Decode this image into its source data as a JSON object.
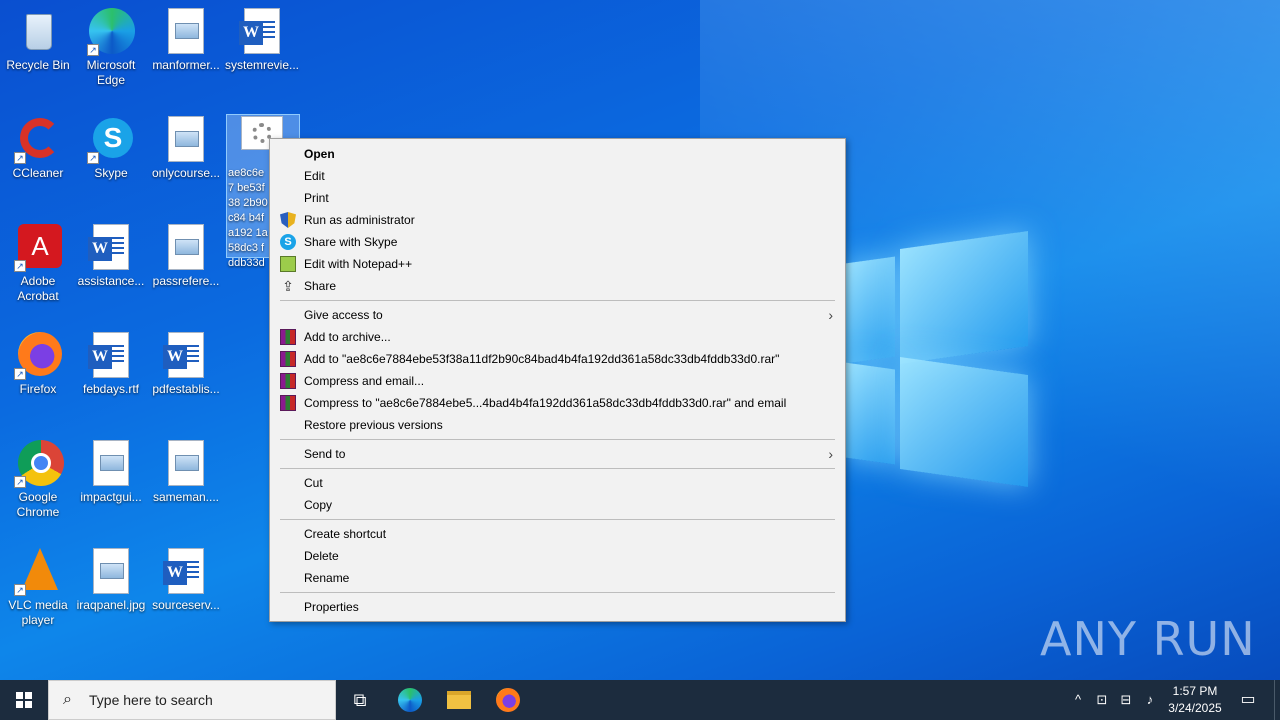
{
  "desktop": {
    "icons": [
      {
        "label": "Recycle Bin",
        "icon": "recycle-bin-icon"
      },
      {
        "label": "Microsoft Edge",
        "icon": "edge-icon"
      },
      {
        "label": "manformer...",
        "icon": "image-file-icon"
      },
      {
        "label": "systemrevie...",
        "icon": "word-doc-icon"
      },
      {
        "label": "CCleaner",
        "icon": "ccleaner-icon"
      },
      {
        "label": "Skype",
        "icon": "skype-icon"
      },
      {
        "label": "onlycourse...",
        "icon": "image-file-icon"
      },
      {
        "label": "ae8c6e7 be53f38 2b90c84 b4fa192 1a58dc3 fddb33d",
        "icon": "settings-file-icon"
      },
      {
        "label": "Adobe Acrobat",
        "icon": "acrobat-icon"
      },
      {
        "label": "assistance...",
        "icon": "word-doc-icon"
      },
      {
        "label": "passrefere...",
        "icon": "image-file-icon"
      },
      {
        "label": "Firefox",
        "icon": "firefox-icon"
      },
      {
        "label": "febdays.rtf",
        "icon": "word-doc-icon"
      },
      {
        "label": "pdfestablis...",
        "icon": "word-doc-icon"
      },
      {
        "label": "Google Chrome",
        "icon": "chrome-icon"
      },
      {
        "label": "impactgui...",
        "icon": "image-file-icon"
      },
      {
        "label": "sameman....",
        "icon": "image-file-icon"
      },
      {
        "label": "VLC media player",
        "icon": "vlc-icon"
      },
      {
        "label": "iraqpanel.jpg",
        "icon": "image-file-icon"
      },
      {
        "label": "sourceserv...",
        "icon": "word-doc-icon"
      }
    ]
  },
  "context_menu": {
    "open": "Open",
    "edit": "Edit",
    "print": "Print",
    "run_as_admin": "Run as administrator",
    "share_skype": "Share with Skype",
    "edit_notepad": "Edit with Notepad++",
    "share": "Share",
    "give_access": "Give access to",
    "add_archive": "Add to archive...",
    "add_to_rar": "Add to \"ae8c6e7884ebe53f38a11df2b90c84bad4b4fa192dd361a58dc33db4fddb33d0.rar\"",
    "compress_email": "Compress and email...",
    "compress_to_rar_email": "Compress to \"ae8c6e7884ebe5...4bad4b4fa192dd361a58dc33db4fddb33d0.rar\" and email",
    "restore_versions": "Restore previous versions",
    "send_to": "Send to",
    "cut": "Cut",
    "copy": "Copy",
    "create_shortcut": "Create shortcut",
    "delete": "Delete",
    "rename": "Rename",
    "properties": "Properties"
  },
  "taskbar": {
    "search_placeholder": "Type here to search",
    "time": "1:57 PM",
    "date": "3/24/2025"
  },
  "watermark": "ANY RUN"
}
